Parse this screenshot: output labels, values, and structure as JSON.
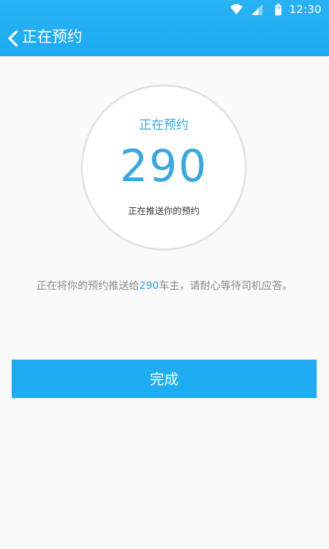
{
  "status_bar": {
    "time": "12:30",
    "icons": [
      "wifi-icon",
      "signal-icon",
      "battery-icon"
    ]
  },
  "app_bar": {
    "back_icon": "chevron-left-icon",
    "title": "正在预约"
  },
  "booking_circle": {
    "title": "正在预约",
    "count": "290",
    "subtitle": "正在推送你的预约"
  },
  "message": {
    "prefix": "正在将你的预约推送给",
    "count": "290",
    "suffix": "车主，请耐心等待司机应答。"
  },
  "actions": {
    "done_label": "完成"
  },
  "colors": {
    "primary": "#1fadf2",
    "highlight_text": "#39a8df",
    "background": "#fafafa"
  }
}
